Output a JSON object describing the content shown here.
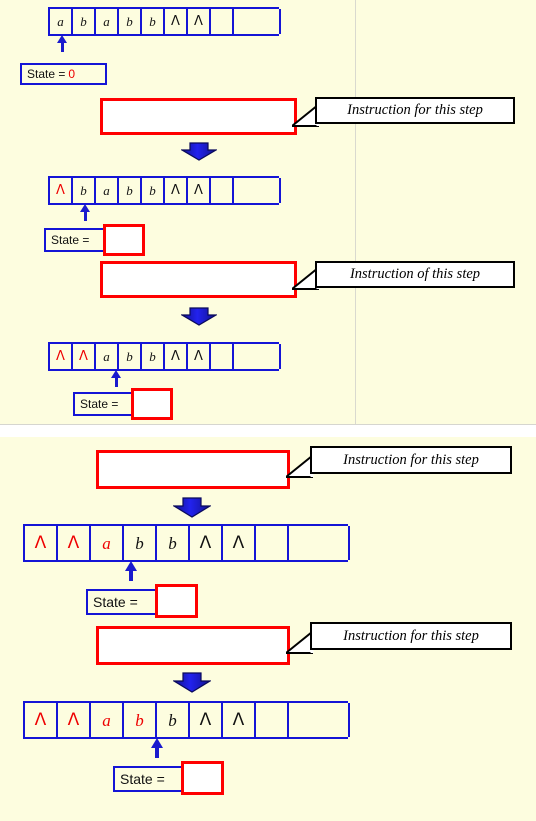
{
  "colors": {
    "background": "#fdfddf",
    "tape_border": "#1414d6",
    "head_arrow": "#1a1acd",
    "instruction_border": "#ff0000",
    "symbol_highlight": "#ee0000",
    "callout_border": "#000000",
    "down_arrow": "#1a1ae0",
    "state_border": "#1414d6"
  },
  "slide1": {
    "steps": [
      {
        "name": "step-1",
        "tape": {
          "cells": [
            {
              "symbol": "a",
              "highlight": false
            },
            {
              "symbol": "b",
              "highlight": false
            },
            {
              "symbol": "a",
              "highlight": false
            },
            {
              "symbol": "b",
              "highlight": false
            },
            {
              "symbol": "b",
              "highlight": false
            },
            {
              "symbol": "Λ",
              "highlight": false
            },
            {
              "symbol": "Λ",
              "highlight": false
            },
            {
              "symbol": "",
              "highlight": false
            },
            {
              "symbol": "",
              "highlight": false
            }
          ],
          "head_index": 0
        },
        "state_label": "State =",
        "state_value": "0",
        "state_value_filled": true
      },
      {
        "name": "step-2",
        "tape": {
          "cells": [
            {
              "symbol": "Λ",
              "highlight": true
            },
            {
              "symbol": "b",
              "highlight": false
            },
            {
              "symbol": "a",
              "highlight": false
            },
            {
              "symbol": "b",
              "highlight": false
            },
            {
              "symbol": "b",
              "highlight": false
            },
            {
              "symbol": "Λ",
              "highlight": false
            },
            {
              "symbol": "Λ",
              "highlight": false
            },
            {
              "symbol": "",
              "highlight": false
            },
            {
              "symbol": "",
              "highlight": false
            }
          ],
          "head_index": 1
        },
        "state_label": "State =",
        "state_value": "",
        "state_value_filled": false
      },
      {
        "name": "step-3",
        "tape": {
          "cells": [
            {
              "symbol": "Λ",
              "highlight": true
            },
            {
              "symbol": "Λ",
              "highlight": true
            },
            {
              "symbol": "a",
              "highlight": false
            },
            {
              "symbol": "b",
              "highlight": false
            },
            {
              "symbol": "b",
              "highlight": false
            },
            {
              "symbol": "Λ",
              "highlight": false
            },
            {
              "symbol": "Λ",
              "highlight": false
            },
            {
              "symbol": "",
              "highlight": false
            },
            {
              "symbol": "",
              "highlight": false
            }
          ],
          "head_index": 2
        },
        "state_label": "State =",
        "state_value": "",
        "state_value_filled": false
      }
    ],
    "instructions": [
      {
        "name": "instruction-1",
        "text": "",
        "callout": "Instruction for this step"
      },
      {
        "name": "instruction-2",
        "text": "",
        "callout": "Instruction of this step"
      }
    ]
  },
  "slide2": {
    "steps": [
      {
        "name": "step-4",
        "tape": {
          "cells": [
            {
              "symbol": "Λ",
              "highlight": true
            },
            {
              "symbol": "Λ",
              "highlight": true
            },
            {
              "symbol": "a",
              "highlight": true
            },
            {
              "symbol": "b",
              "highlight": false
            },
            {
              "symbol": "b",
              "highlight": false
            },
            {
              "symbol": "Λ",
              "highlight": false
            },
            {
              "symbol": "Λ",
              "highlight": false
            },
            {
              "symbol": "",
              "highlight": false
            },
            {
              "symbol": "",
              "highlight": false
            }
          ],
          "head_index": 3
        },
        "state_label": "State =",
        "state_value": "",
        "state_value_filled": false
      },
      {
        "name": "step-5",
        "tape": {
          "cells": [
            {
              "symbol": "Λ",
              "highlight": true
            },
            {
              "symbol": "Λ",
              "highlight": true
            },
            {
              "symbol": "a",
              "highlight": true
            },
            {
              "symbol": "b",
              "highlight": true
            },
            {
              "symbol": "b",
              "highlight": false
            },
            {
              "symbol": "Λ",
              "highlight": false
            },
            {
              "symbol": "Λ",
              "highlight": false
            },
            {
              "symbol": "",
              "highlight": false
            },
            {
              "symbol": "",
              "highlight": false
            }
          ],
          "head_index": 4
        },
        "state_label": "State =",
        "state_value": "",
        "state_value_filled": false
      }
    ],
    "instructions": [
      {
        "name": "instruction-3",
        "text": "",
        "callout": "Instruction for this step"
      },
      {
        "name": "instruction-4",
        "text": "",
        "callout": "Instruction for this step"
      }
    ]
  }
}
